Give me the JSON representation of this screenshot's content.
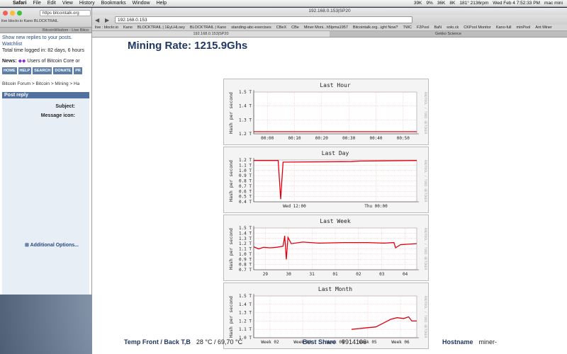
{
  "menubar": {
    "items": [
      "Safari",
      "File",
      "Edit",
      "View",
      "History",
      "Bookmarks",
      "Window",
      "Help"
    ],
    "status": [
      "39K",
      "9%",
      "36K",
      "8K",
      "181° 2136rpm"
    ],
    "datetime": "Wed Feb 4  7:52:33 PM",
    "user": "mac mini"
  },
  "backwin": {
    "url": "https bitcointalk.org",
    "bookmarks": "live blockr.io Kano BLOCKTRAIL",
    "tab": "BitcoinWisdom - Live Bitco",
    "watchlist": "Watchlist",
    "top_line": "Show new replies to your posts.",
    "logged": "Total time logged in: 82 days, 6 hours",
    "news_label": "News:",
    "news_text": "Users of Bitcoin Core or",
    "nav": [
      "HOME",
      "HELP",
      "SEARCH",
      "DONATE",
      "PR"
    ],
    "breadcrumb": "Bitcoin Forum > Bitcoin > Mining > Ha",
    "post_reply": "Post reply",
    "subject": "Subject:",
    "message_icon": "Message icon:",
    "additional": "Additional Options..."
  },
  "mainwin": {
    "title": "192.168.0.153|SP20",
    "url": "192.168.0.153",
    "bookmarks": [
      "live : blockr.io",
      "Kano",
      "BLOCKTRAIL | 1EyLHLoey",
      "BLOCKTRAIL | Kano",
      "standing-abc-exercises",
      "CBeX",
      "CBe",
      "Miner Moni...h5lpma1957",
      "Bitcointalk.org...ight Now?",
      "TWC",
      "F2Pool",
      "BaN",
      "solo.ck",
      "CKPool Monitor",
      "Kano-full",
      "minPool",
      "Ant Miner"
    ],
    "tabs": [
      "192.168.0.153|SP20",
      "Gekko Science"
    ],
    "headline": "Mining Rate: 1215.9Ghs"
  },
  "chart_data": [
    {
      "type": "line",
      "title": "Last Hour",
      "ylabel": "Hash per second",
      "side_label": "RRDTOOL / TOBI OETIKER",
      "yticks": [
        "1.5 T",
        "1.4 T",
        "1.3 T",
        "1.2 T"
      ],
      "ylim": [
        1.2,
        1.5
      ],
      "xticks": [
        "00:00",
        "00:10",
        "00:20",
        "00:30",
        "00:40",
        "00:50"
      ],
      "series": [
        {
          "values": [
            [
              0,
              1.215
            ],
            [
              1,
              1.215
            ]
          ]
        }
      ]
    },
    {
      "type": "line",
      "title": "Last Day",
      "ylabel": "Hash per second",
      "side_label": "RRDTOOL / TOBI OETIKER",
      "yticks": [
        "1.2 T",
        "1.1 T",
        "1.0 T",
        "0.9 T",
        "0.8 T",
        "0.7 T",
        "0.6 T",
        "0.5 T",
        "0.4 T"
      ],
      "ylim": [
        0.4,
        1.2
      ],
      "xticks": [
        "Wed 12:00",
        "Thu 00:00"
      ],
      "series": [
        {
          "values": [
            [
              0,
              1.19
            ],
            [
              0.15,
              1.19
            ],
            [
              0.165,
              0.45
            ],
            [
              0.18,
              1.16
            ],
            [
              0.6,
              1.17
            ],
            [
              0.65,
              1.18
            ],
            [
              1,
              1.19
            ]
          ]
        }
      ]
    },
    {
      "type": "line",
      "title": "Last Week",
      "ylabel": "Hash per second",
      "side_label": "RRDTOOL / TOBI OETIKER",
      "yticks": [
        "1.5 T",
        "1.4 T",
        "1.3 T",
        "1.2 T",
        "1.1 T",
        "1.0 T",
        "0.9 T",
        "0.8 T",
        "0.7 T"
      ],
      "ylim": [
        0.7,
        1.5
      ],
      "xticks": [
        "29",
        "30",
        "31",
        "01",
        "02",
        "03",
        "04"
      ],
      "series": [
        {
          "values": [
            [
              0,
              1.14
            ],
            [
              0.03,
              1.1
            ],
            [
              0.06,
              1.13
            ],
            [
              0.1,
              1.12
            ],
            [
              0.14,
              1.13
            ],
            [
              0.18,
              1.15
            ],
            [
              0.19,
              1.35
            ],
            [
              0.2,
              0.9
            ],
            [
              0.21,
              1.32
            ],
            [
              0.23,
              1.2
            ],
            [
              0.3,
              1.23
            ],
            [
              0.4,
              1.21
            ],
            [
              0.55,
              1.22
            ],
            [
              0.7,
              1.22
            ],
            [
              0.8,
              1.21
            ],
            [
              0.86,
              1.22
            ],
            [
              0.87,
              1.12
            ],
            [
              0.9,
              1.18
            ],
            [
              1,
              1.2
            ]
          ]
        }
      ]
    },
    {
      "type": "line",
      "title": "Last Month",
      "ylabel": "Hash per second",
      "side_label": "RRDTOOL / TOBI OETIKER",
      "yticks": [
        "1.5 T",
        "1.4 T",
        "1.3 T",
        "1.2 T",
        "1.1 T",
        "1.0 T"
      ],
      "ylim": [
        1.0,
        1.5
      ],
      "xticks": [
        "Week 02",
        "Week 03",
        "Week 04",
        "Week 05",
        "Week 06"
      ],
      "series": [
        {
          "values": [
            [
              0.6,
              1.1
            ],
            [
              0.65,
              1.11
            ],
            [
              0.7,
              1.12
            ],
            [
              0.75,
              1.13
            ],
            [
              0.8,
              1.18
            ],
            [
              0.84,
              1.22
            ],
            [
              0.88,
              1.24
            ],
            [
              0.92,
              1.23
            ],
            [
              0.95,
              1.25
            ],
            [
              0.97,
              1.2
            ],
            [
              1,
              1.2
            ]
          ]
        }
      ]
    }
  ],
  "stats": {
    "temp_label": "Temp Front / Back T,B",
    "temp_value": "28 °C / 69,70 °C",
    "best_label": "Best Share",
    "best_value": "9914106",
    "host_label": "Hostname",
    "host_value": "miner-"
  },
  "colors": {
    "headline": "#1f3864",
    "line": "#e0000d",
    "grid": "#f2b8b8"
  }
}
